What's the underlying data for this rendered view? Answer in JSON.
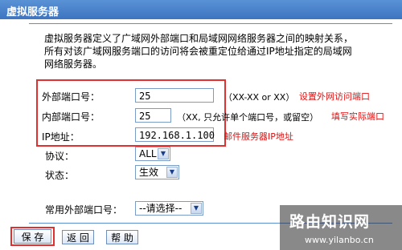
{
  "window": {
    "title": "虚拟服务器"
  },
  "description": [
    "虚拟服务器定义了广域网外部端口和局域网网络服务器之间的映射关系，",
    "所有对该广域网服务端口的访问将会被重定位给通过IP地址指定的局域网",
    "网络服务器。"
  ],
  "form": {
    "external_port": {
      "label": "外部端口号：",
      "value": "25",
      "hint": "（XX-XX or XX）",
      "annotation": "设置外网访问端口"
    },
    "internal_port": {
      "label": "内部端口号：",
      "value": "25",
      "hint": "（XX, 只允许单个端口号，或留空）",
      "annotation": "填写实际端口"
    },
    "ip_address": {
      "label": "IP地址：",
      "value": "192.168.1.100",
      "annotation": "邮件服务器IP地址"
    },
    "protocol": {
      "label": "协议：",
      "selected": "ALL"
    },
    "status": {
      "label": "状态：",
      "selected": "生效"
    },
    "common_port": {
      "label": "常用外部端口号：",
      "selected": "--请选择--"
    }
  },
  "buttons": {
    "save": "保 存",
    "back": "返 回",
    "help": "帮 助"
  },
  "watermark": {
    "title": "路由知识网",
    "url": "www.yilanbo.cn"
  },
  "colors": {
    "title_bar": "#3d74c0",
    "annotation_red": "#e01010",
    "highlight_border": "#e03030"
  }
}
